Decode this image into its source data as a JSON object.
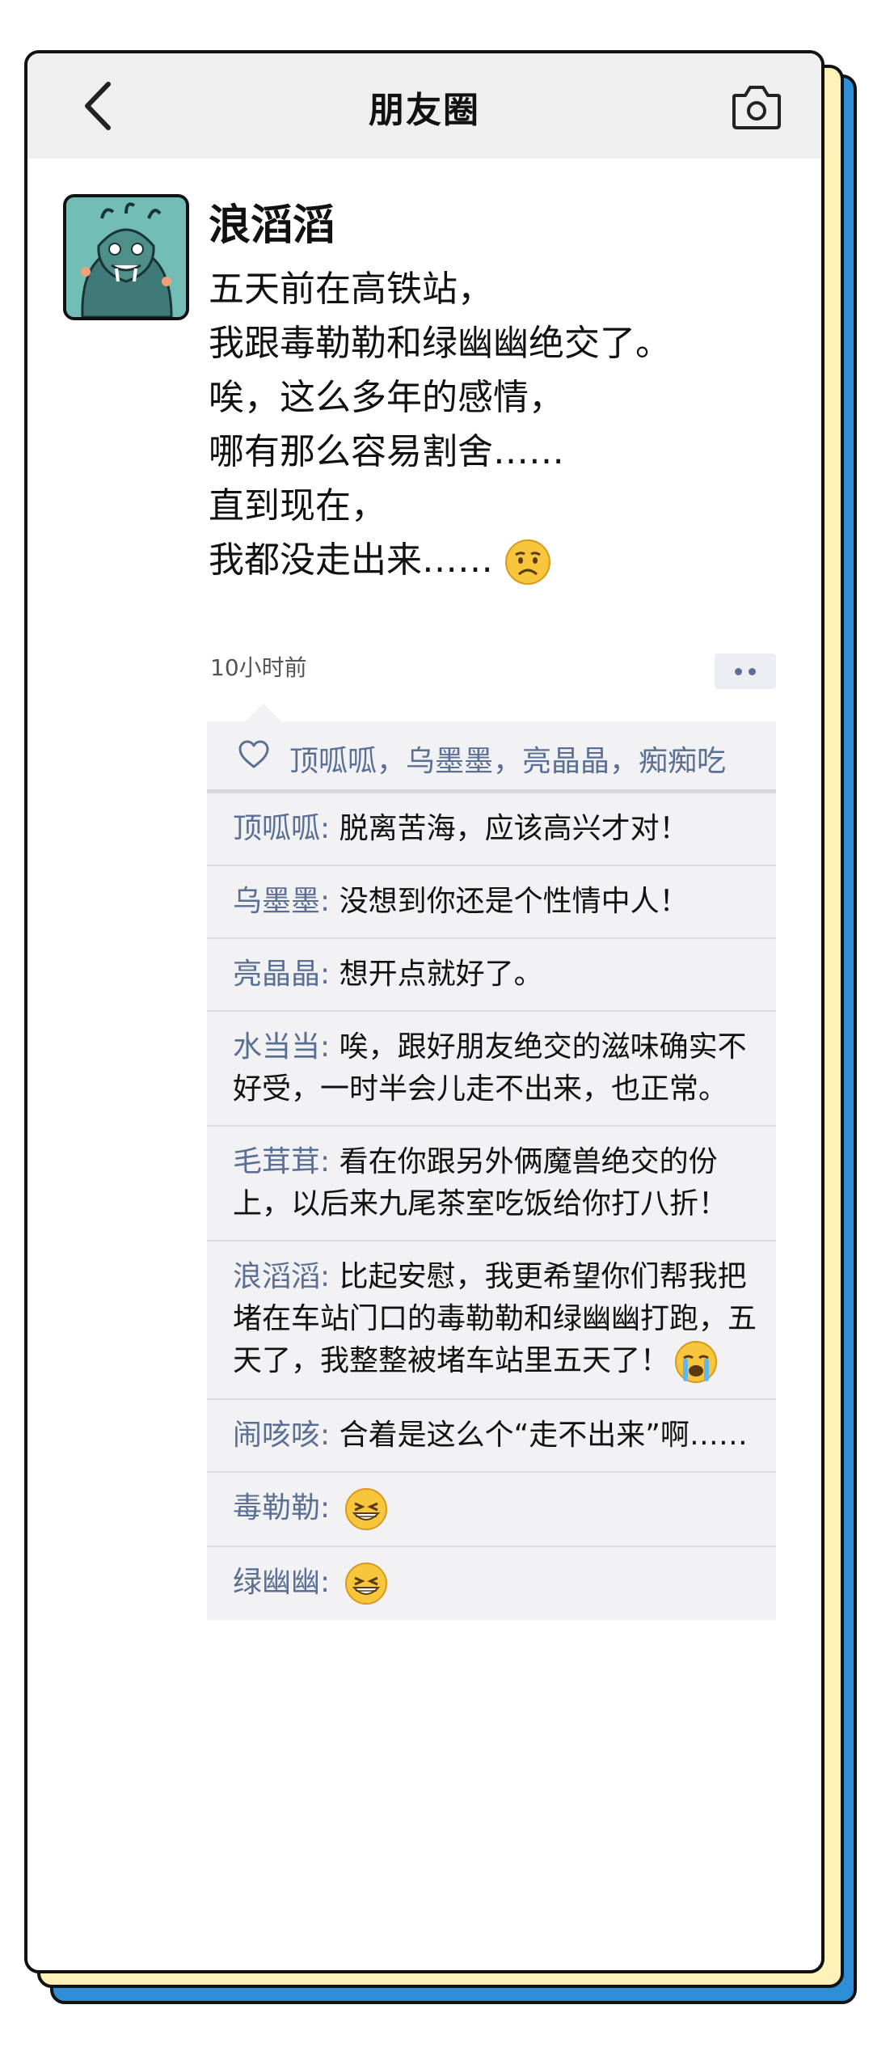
{
  "nav": {
    "title": "朋友圈",
    "back_icon": "chevron-left-icon",
    "camera_icon": "camera-icon"
  },
  "post": {
    "author": "浪滔滔",
    "lines": [
      "五天前在高铁站，",
      "我跟毒勒勒和绿幽幽绝交了。",
      "唉，这么多年的感情，",
      "哪有那么容易割舍……",
      "直到现在，",
      "我都没走出来……"
    ],
    "end_emoji": "sad-face-emoji",
    "time": "10小时前"
  },
  "likes": {
    "icon": "heart-outline-icon",
    "names": "顶呱呱，乌墨墨，亮晶晶，痴痴吃"
  },
  "comments": [
    {
      "name": "顶呱呱",
      "text": "脱离苦海，应该高兴才对！"
    },
    {
      "name": "乌墨墨",
      "text": "没想到你还是个性情中人！"
    },
    {
      "name": "亮晶晶",
      "text": "想开点就好了。"
    },
    {
      "name": "水当当",
      "text": "唉，跟好朋友绝交的滋味确实不好受，一时半会儿走不出来，也正常。"
    },
    {
      "name": "毛茸茸",
      "text": "看在你跟另外俩魔兽绝交的份上，以后来九尾茶室吃饭给你打八折！"
    },
    {
      "name": "浪滔滔",
      "text": "比起安慰，我更希望你们帮我把堵在车站门口的毒勒勒和绿幽幽打跑，五天了，我整整被堵车站里五天了！",
      "emoji": "crying-face-emoji"
    },
    {
      "name": "闹咳咳",
      "text": "合着是这么个“走不出来”啊……"
    },
    {
      "name": "毒勒勒",
      "text": "",
      "emoji": "grinning-face-emoji"
    },
    {
      "name": "绿幽幽",
      "text": "",
      "emoji": "grinning-face-emoji"
    }
  ],
  "colors": {
    "link": "#5b6f94",
    "navbar_bg": "#efefef",
    "feedback_bg": "#f2f2f4",
    "back_layer_blue": "#2e8fd6",
    "back_layer_yellow": "#fff2b8"
  }
}
